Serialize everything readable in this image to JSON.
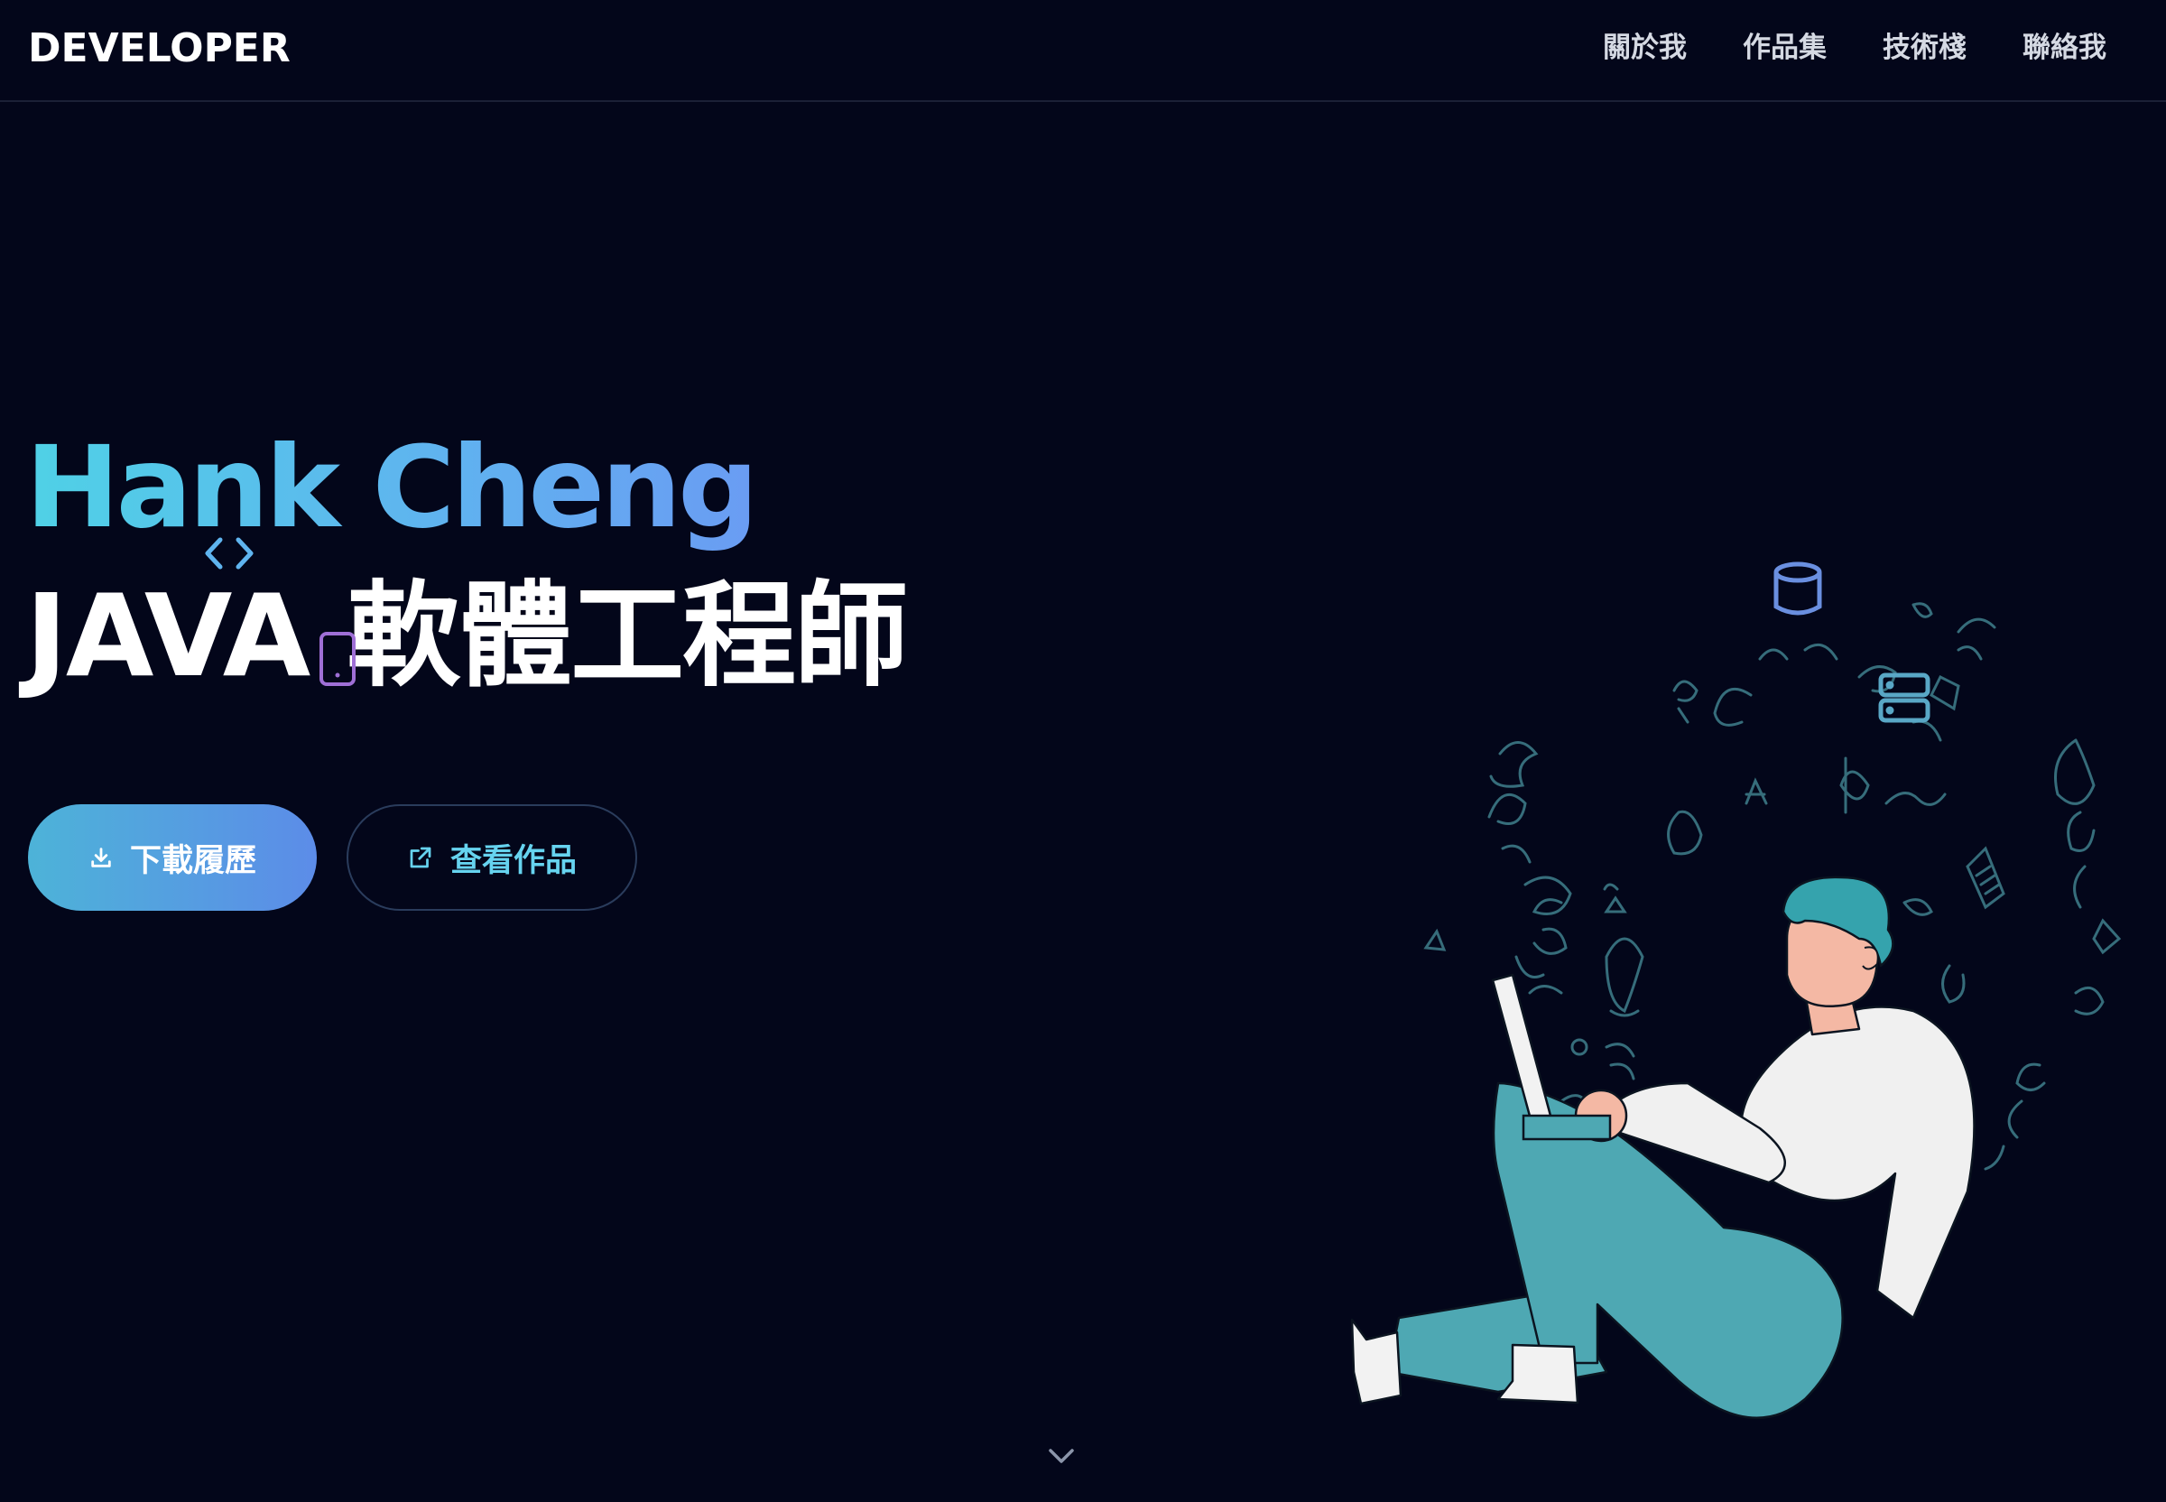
{
  "nav": {
    "brand": "DEVELOPER",
    "links": [
      {
        "label": "關於我"
      },
      {
        "label": "作品集"
      },
      {
        "label": "技術棧"
      },
      {
        "label": "聯絡我"
      }
    ]
  },
  "hero": {
    "name": "Hank Cheng",
    "role": "JAVA 軟體工程師"
  },
  "actions": {
    "download_label": "下載履歷",
    "portfolio_label": "查看作品"
  },
  "icons": {
    "download": "download-icon",
    "external_link": "external-link-icon",
    "code": "code-icon",
    "phone": "mobile-icon",
    "database": "database-icon",
    "server": "server-icon",
    "scroll": "chevron-down-icon"
  },
  "colors": {
    "background": "#03061a",
    "accent_gradient_start": "#4fd1e6",
    "accent_gradient_end": "#6a9cf3",
    "secondary_text": "#66d3ef",
    "illustration_teal": "#4ea8b3"
  }
}
